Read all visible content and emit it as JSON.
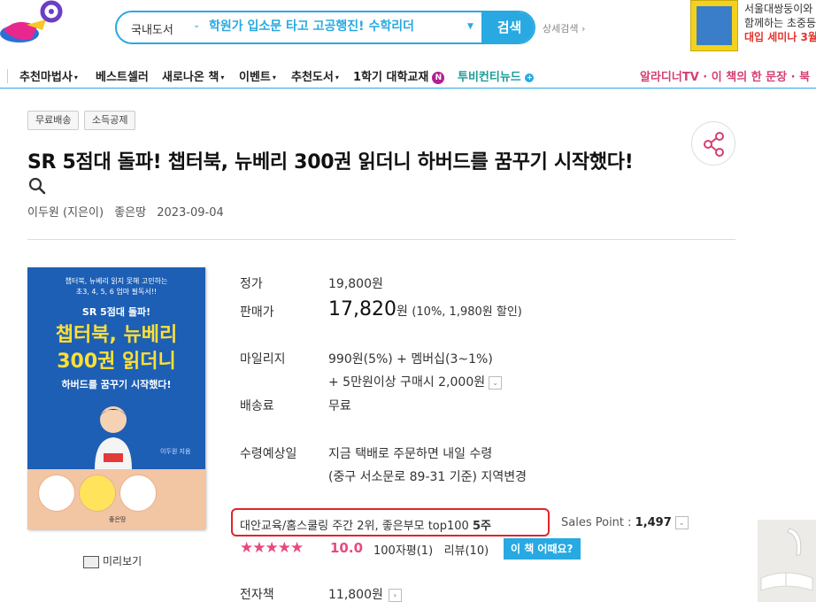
{
  "header": {
    "search": {
      "category": "국내도서",
      "query": "학원가 입소문 타고 고공행진! 수학리더",
      "button_label": "검색",
      "detail_label": "상세검색"
    },
    "banner": {
      "line1": "서울대쌍둥이와",
      "line2": "함께하는 초중등",
      "line3": "대입 세미나 3월"
    }
  },
  "gnb": {
    "items": [
      {
        "label": "추천마법사",
        "arrow": "▾"
      },
      {
        "label": "베스트셀러",
        "arrow": ""
      },
      {
        "label": "새로나온 책",
        "arrow": "▾"
      },
      {
        "label": "이벤트",
        "arrow": "▾"
      },
      {
        "label": "추천도서",
        "arrow": "▾"
      },
      {
        "label": "1학기 대학교재",
        "badge": "N"
      },
      {
        "label": "투비컨티뉴드",
        "badge": "+"
      }
    ],
    "right_text": "알라디너TV · 이 책의 한 문장 · 북"
  },
  "product": {
    "tags": [
      "무료배송",
      "소득공제"
    ],
    "title": "SR 5점대 돌파! 챕터북, 뉴베리 300권 읽더니 하버드를 꿈꾸기 시작했다!",
    "author": "이두원 (지은이)",
    "publisher": "좋은땅",
    "date": "2023-09-04",
    "cover": {
      "sub_line1": "챕터북, 뉴베리 읽지 못해 고민하는",
      "sub_line2": "초3, 4, 5, 6 엄마 필독서!!",
      "sr": "SR 5점대 돌파!",
      "main1": "챕터북, 뉴베리",
      "main2": "300권 읽더니",
      "main3": "하버드를 꿈꾸기 시작했다!",
      "author": "이두원 지음",
      "publisher": "좋은땅"
    },
    "preview_label": "미리보기"
  },
  "info": {
    "list_price_label": "정가",
    "list_price": "19,800원",
    "sale_price_label": "판매가",
    "sale_price": "17,820",
    "sale_unit": "원",
    "discount": "(10%, 1,980원 할인)",
    "mileage_label": "마일리지",
    "mileage_line1": "990원(5%) + 멤버십(3~1%)",
    "mileage_line2": "+ 5만원이상 구매시 2,000원",
    "shipping_label": "배송료",
    "shipping": "무료",
    "delivery_label": "수령예상일",
    "delivery_line1": "지금 택배로 주문하면 내일 수령",
    "delivery_line2": "(중구 서소문로 89-31 기준) 지역변경",
    "rank_prefix": "대안교육/홈스쿨링 주간 2위, 좋은부모 top100 ",
    "rank_weeks": "5주",
    "sales_point_label": "Sales Point : ",
    "sales_point": "1,497",
    "stars": "★★★★★",
    "rating": "10.0",
    "review_count": "100자평(1)",
    "review_link": "리뷰(10)",
    "how_button": "이 책 어때요?",
    "ebook_label": "전자책",
    "ebook_price": "11,800원"
  },
  "colors": {
    "accent": "#28a9e2",
    "rank_border": "#e0242c",
    "star": "#e84a7e"
  }
}
